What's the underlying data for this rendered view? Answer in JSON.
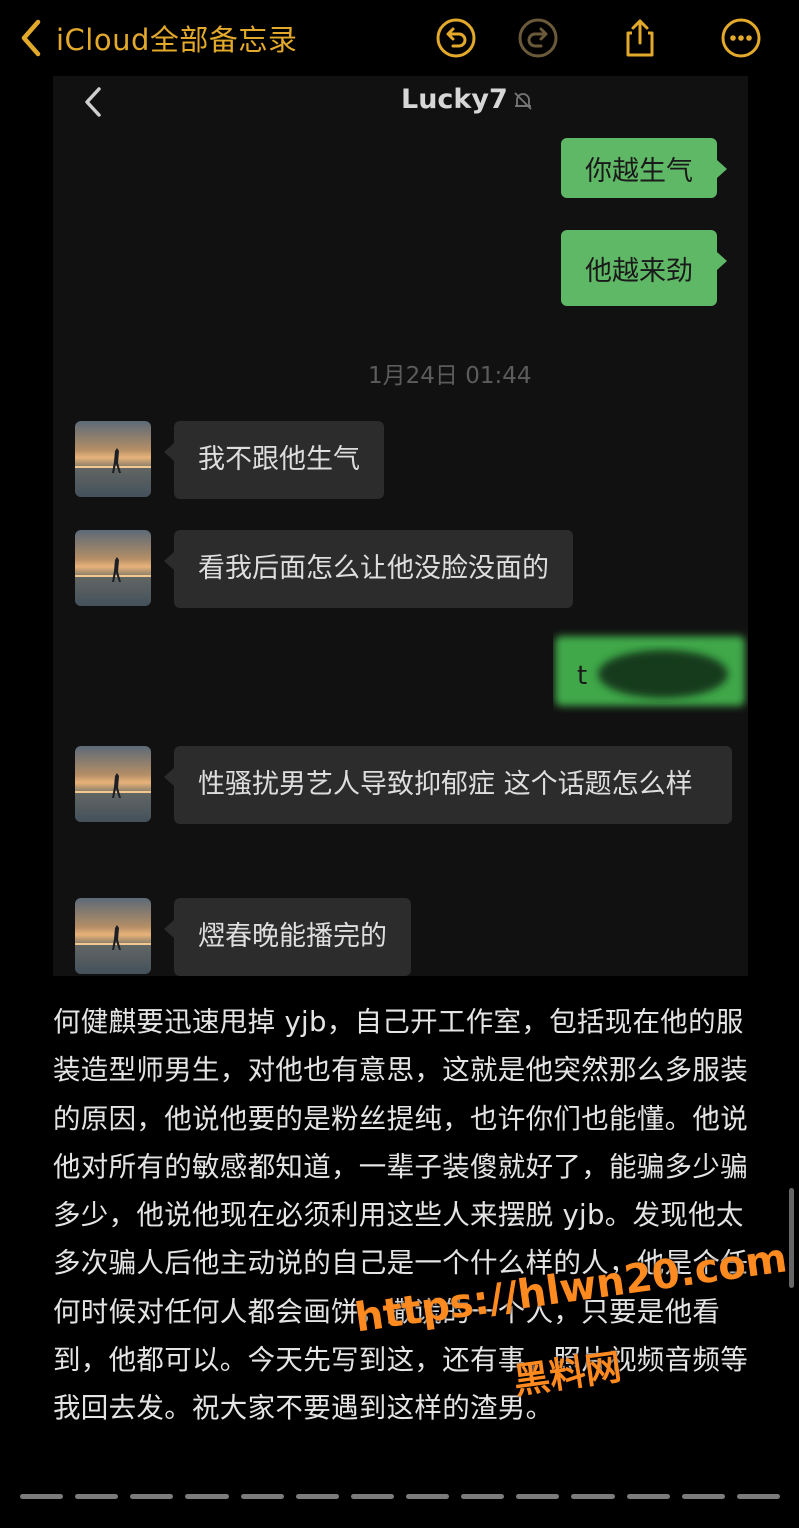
{
  "topbar": {
    "back_label": "iCloud全部备忘录",
    "accent_color": "#e2a92b",
    "icons": [
      "undo-icon",
      "redo-icon",
      "share-icon",
      "more-icon"
    ]
  },
  "chat": {
    "contact_name": "Lucky7",
    "muted_icon": "bell-slash-icon",
    "outgoing": [
      "你越生气",
      "他越来劲"
    ],
    "timestamp": "1月24日 01:44",
    "incoming": [
      "我不跟他生气",
      "看我后面怎么让他没脸没面的",
      "性骚扰男艺人导致抑郁症 这个话题怎么样",
      "熤春晚能播完的"
    ],
    "outgoing_redacted_char": "t"
  },
  "note": {
    "body": "何健麒要迅速甩掉 yjb，自己开工作室，包括现在他的服装造型师男生，对他也有意思，这就是他突然那么多服装的原因，他说他要的是粉丝提纯，也许你们也能懂。他说他对所有的敏感都知道，一辈子装傻就好了，能骗多少骗多少，他说他现在必须利用这些人来摆脱 yjb。发现他太多次骗人后他主动说的自己是一个什么样的人，他是个任何时候对任何人都会画饼，撒谎的一个人，只要是他看到，他都可以。今天先写到这，还有事，照片视频音频等我回去发。祝大家不要遇到这样的渣男。"
  },
  "watermark": {
    "url": "https://hlwn20.com",
    "name": "黑料网"
  }
}
